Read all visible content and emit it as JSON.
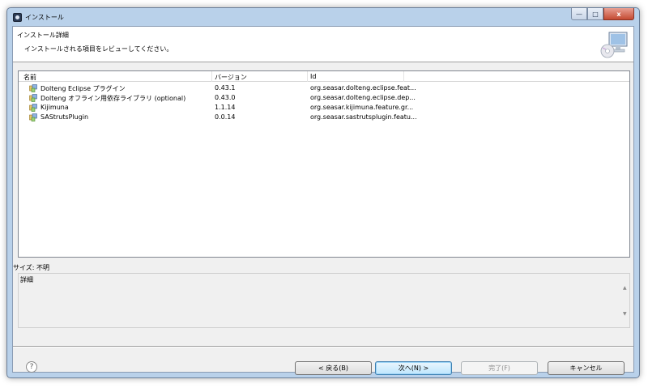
{
  "window": {
    "title": "インストール",
    "caption_buttons": {
      "minimize": "—",
      "maximize": "□",
      "close": "x"
    }
  },
  "header": {
    "title": "インストール詳細",
    "description": "インストールされる項目をレビューしてください。"
  },
  "table": {
    "columns": [
      "名前",
      "バージョン",
      "Id"
    ],
    "rows": [
      {
        "name": "Dolteng Eclipse プラグイン",
        "version": "0.43.1",
        "id": "org.seasar.dolteng.eclipse.feat..."
      },
      {
        "name": "Dolteng オフライン用依存ライブラリ (optional)",
        "version": "0.43.0",
        "id": "org.seasar.dolteng.eclipse.dep..."
      },
      {
        "name": "Kijimuna",
        "version": "1.1.14",
        "id": "org.seasar.kijimuna.feature.gr..."
      },
      {
        "name": "SAStrutsPlugin",
        "version": "0.0.14",
        "id": "org.seasar.sastrutsplugin.featu..."
      }
    ]
  },
  "size_label": "サイズ: 不明",
  "details_label": "詳細",
  "buttons": {
    "help": "?",
    "back": "< 戻る(B)",
    "next": "次へ(N) >",
    "finish": "完了(F)",
    "cancel": "キャンセル"
  },
  "colors": {
    "window_frame": "#b9d1ea",
    "close_button": "#c44a32",
    "default_button": "#bee6fd"
  }
}
